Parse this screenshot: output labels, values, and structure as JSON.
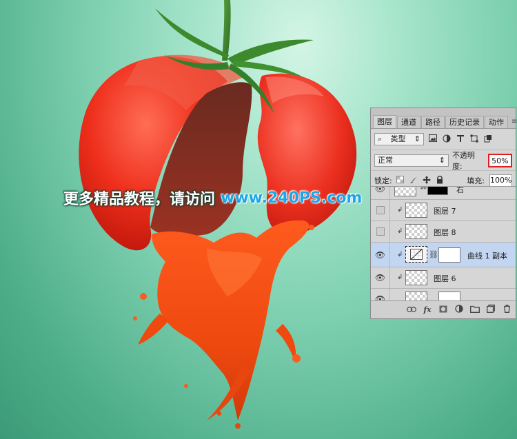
{
  "watermark": {
    "text_cn": "更多精品教程，请访问",
    "text_url": "www.240PS.com"
  },
  "panel": {
    "tabs": [
      {
        "label": "图层",
        "active": true
      },
      {
        "label": "通道",
        "active": false
      },
      {
        "label": "路径",
        "active": false
      },
      {
        "label": "历史记录",
        "active": false
      },
      {
        "label": "动作",
        "active": false
      }
    ],
    "menu_icon": "≡",
    "filter": {
      "search_icon": "⌕",
      "label": "类型",
      "arrow": "⇕"
    },
    "blend": {
      "mode": "正常",
      "arrow": "⇕"
    },
    "opacity": {
      "label": "不透明度:",
      "value": "50%"
    },
    "lock": {
      "label": "锁定:"
    },
    "fill": {
      "label": "填充:",
      "value": "100%"
    },
    "layers": [
      {
        "name": "右",
        "visible": true,
        "clipped": false,
        "type": "masked",
        "selected": false
      },
      {
        "name": "图层 7",
        "visible": false,
        "clipped": true,
        "type": "pixel",
        "selected": false
      },
      {
        "name": "图层 8",
        "visible": false,
        "clipped": true,
        "type": "pixel",
        "selected": false
      },
      {
        "name": "曲线 1 副本",
        "visible": true,
        "clipped": true,
        "type": "adjustment",
        "selected": true
      },
      {
        "name": "图层 6",
        "visible": true,
        "clipped": true,
        "type": "pixel",
        "selected": false
      },
      {
        "name": "",
        "visible": true,
        "clipped": false,
        "type": "masked-partial",
        "selected": false
      }
    ]
  },
  "colors": {
    "opacity_highlight": "#e02020",
    "selected_layer": "#c3d6f1",
    "watermark_url": "#1aa6e8"
  }
}
